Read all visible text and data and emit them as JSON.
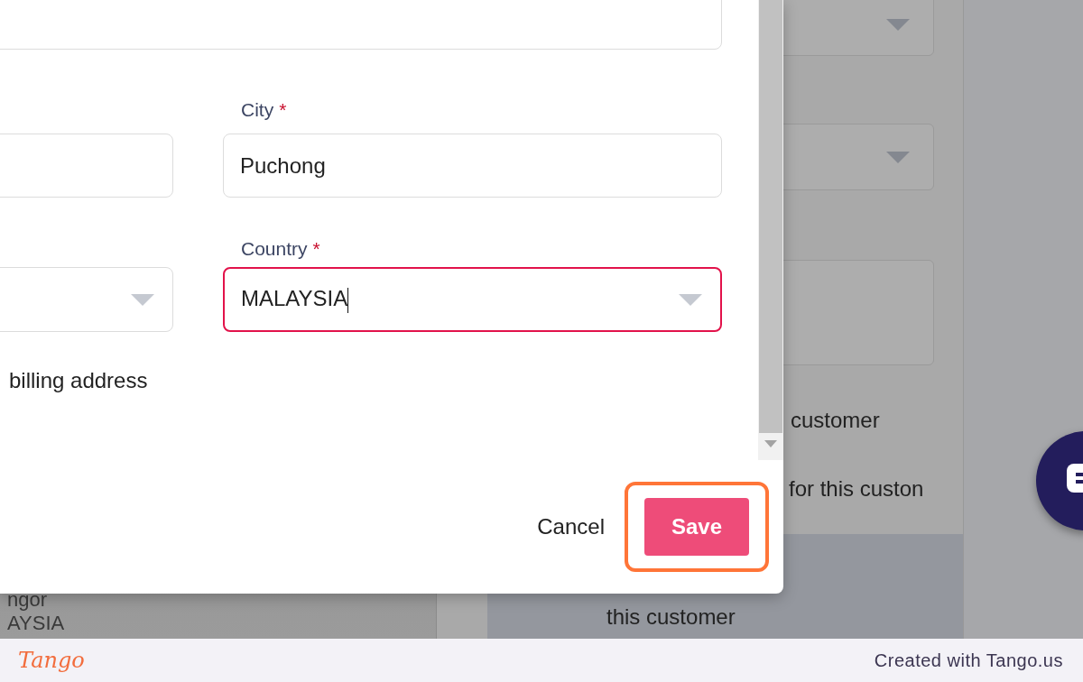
{
  "background": {
    "left_texts": [
      "ngor",
      "AYSIA"
    ],
    "fields": [
      {
        "kind": "select"
      },
      {
        "kind": "select"
      },
      {
        "kind": "textarea"
      }
    ],
    "options": [
      {
        "label": "customer",
        "selected": false
      },
      {
        "label": "for this custon",
        "selected": false
      },
      {
        "label": "this customer",
        "selected": true
      }
    ]
  },
  "dialog": {
    "top_field": {
      "kind": "input"
    },
    "rows": [
      {
        "left": {
          "kind": "input"
        },
        "right": {
          "kind": "input",
          "label": "City",
          "required_mark": "*",
          "value": "Puchong",
          "focused": false
        }
      },
      {
        "left": {
          "kind": "select"
        },
        "right": {
          "kind": "select",
          "label": "Country",
          "required_mark": "*",
          "value": "MALAYSIA",
          "focused": true
        }
      }
    ],
    "checkbox_label": "billing address",
    "buttons": [
      {
        "label": "Cancel",
        "kind": "text",
        "highlighted": false
      },
      {
        "label": "Save",
        "kind": "primary",
        "highlighted": true
      }
    ]
  },
  "footer": {
    "brand": "Tango",
    "credit": "Created with Tango.us"
  }
}
